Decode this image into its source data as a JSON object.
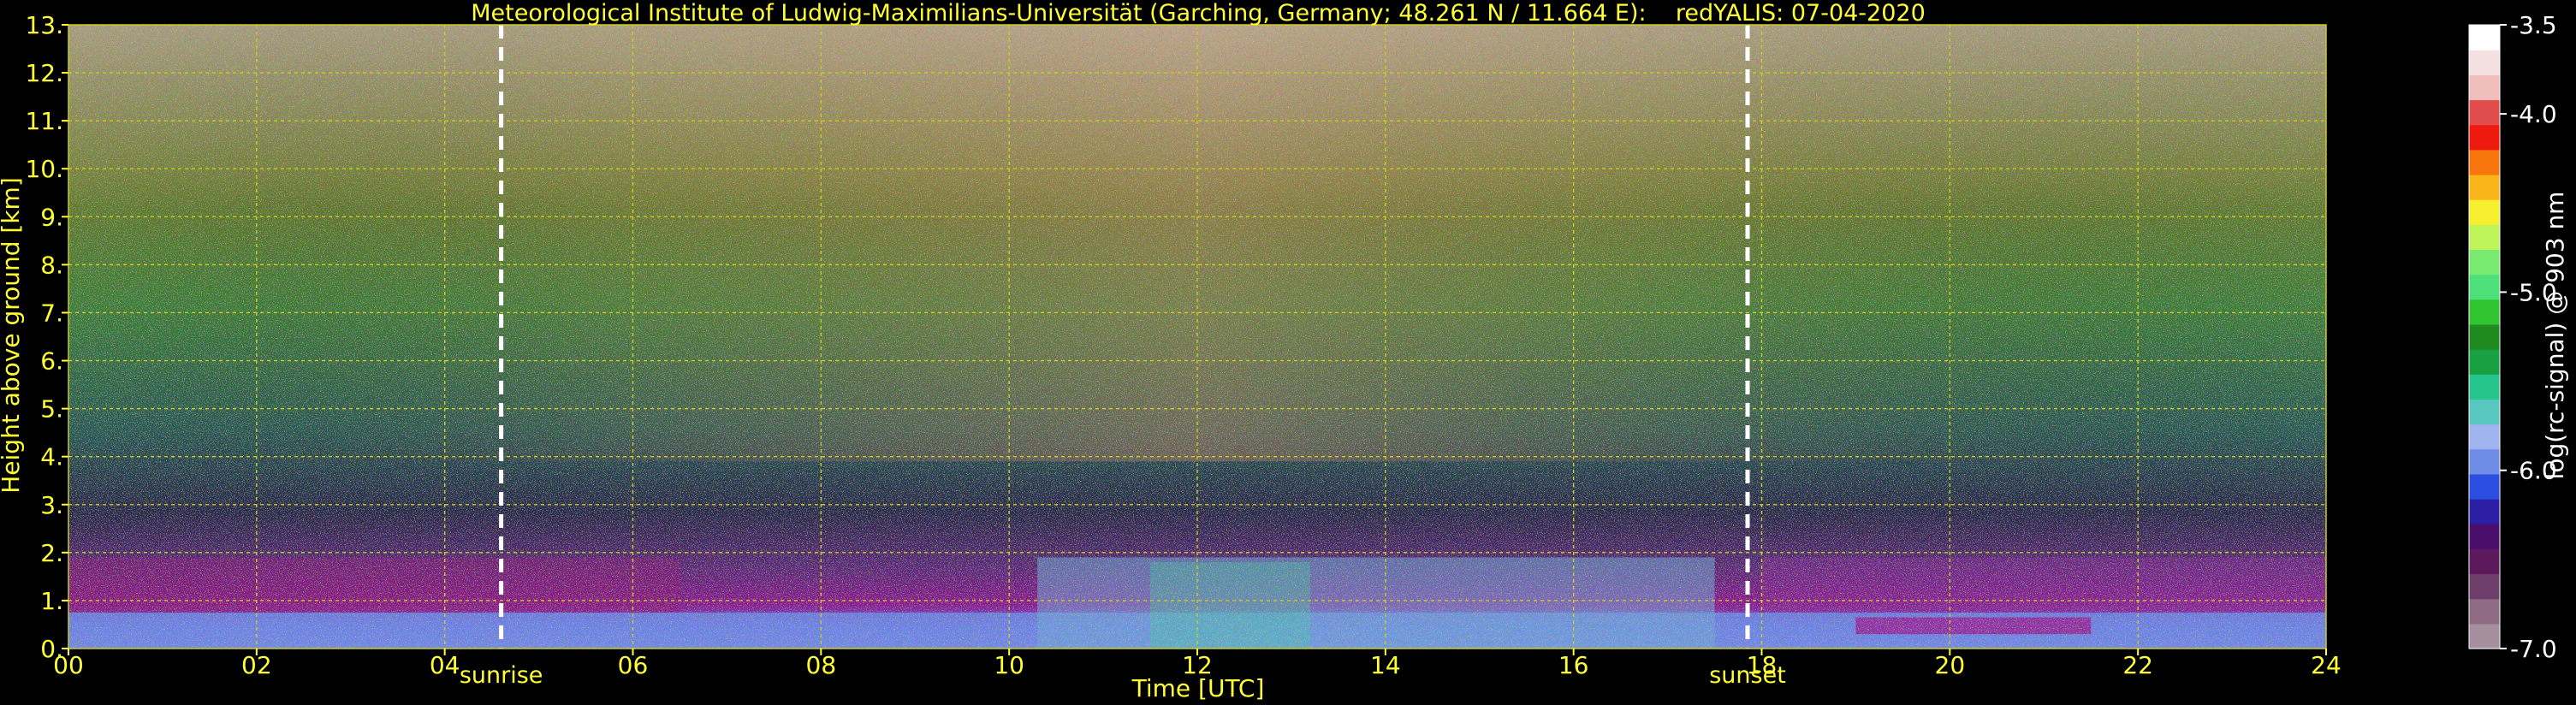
{
  "chart_data": {
    "type": "heatmap",
    "title": "Meteorological Institute of Ludwig-Maximilians-Universität (Garching, Germany; 48.261 N / 11.664 E):    redYALIS: 07-04-2020",
    "xlabel": "Time [UTC]",
    "ylabel": "Height above ground [km]",
    "xlim": [
      0,
      24
    ],
    "ylim": [
      0,
      13
    ],
    "xticks": [
      0,
      2,
      4,
      6,
      8,
      10,
      12,
      14,
      16,
      18,
      20,
      22,
      24
    ],
    "xtick_labels": [
      "00",
      "02",
      "04",
      "06",
      "08",
      "10",
      "12",
      "14",
      "16",
      "18",
      "20",
      "22",
      "24"
    ],
    "yticks": [
      0,
      1,
      2,
      3,
      4,
      5,
      6,
      7,
      8,
      9,
      10,
      11,
      12,
      13
    ],
    "ytick_labels": [
      "0.",
      "1.",
      "2.",
      "3.",
      "4.",
      "5.",
      "6.",
      "7.",
      "8.",
      "9.",
      "10.",
      "11.",
      "12.",
      "13."
    ],
    "grid": true,
    "events": [
      {
        "label": "sunrise",
        "time": 4.6
      },
      {
        "label": "sunset",
        "time": 17.85
      }
    ],
    "colorbar": {
      "label": "log(rc-signal) @ 903 nm",
      "range": [
        -7.0,
        -3.5
      ],
      "ticks": [
        -3.5,
        -4.0,
        -5.0,
        -6.0,
        -7.0
      ],
      "tick_labels": [
        "-3.5",
        "-4.0",
        "-5.0",
        "-6.0",
        "-7.0"
      ],
      "colors": [
        "#a58f9f",
        "#8e6b83",
        "#6d3e69",
        "#5c1a5d",
        "#4a0f6a",
        "#2c1fa6",
        "#2b4de0",
        "#6f8de6",
        "#9fb3ef",
        "#57c7c0",
        "#27c58e",
        "#18a043",
        "#1f8a1f",
        "#31c431",
        "#4de07a",
        "#79ea70",
        "#bef35a",
        "#f6ef2e",
        "#f9b51a",
        "#f9760f",
        "#ef1a0f",
        "#e04c4c",
        "#f0bdbd",
        "#f4e0e0",
        "#ffffff"
      ]
    },
    "colors": {
      "text": "#ffff33",
      "grid": "#cccc22",
      "background": "#000000",
      "event_line": "#ffffff"
    }
  }
}
